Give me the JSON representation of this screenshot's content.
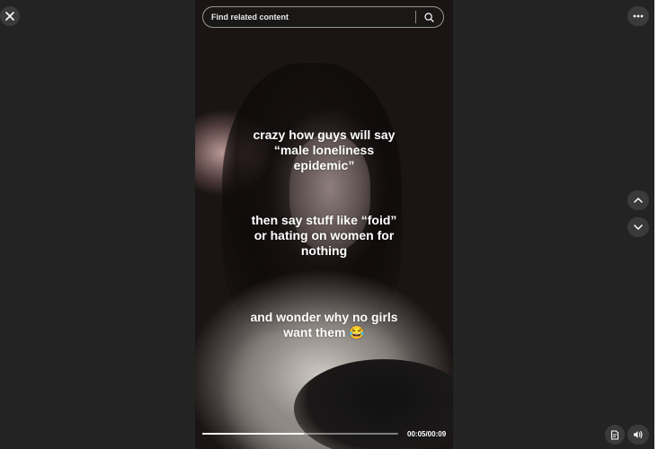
{
  "search": {
    "placeholder": "Find related content"
  },
  "captions": {
    "line1": "crazy how guys will say “male loneliness epidemic”",
    "line2": "then say stuff like “foid” or hating on women for nothing",
    "line3": "and wonder why no girls want them 😂"
  },
  "player": {
    "time": "00:05/00:09",
    "progress_fraction": 0.52
  },
  "icons": {
    "close": "close-icon",
    "more": "more-horizontal-icon",
    "search": "search-icon",
    "up": "chevron-up-icon",
    "down": "chevron-down-icon",
    "captions": "captions-icon",
    "volume": "volume-icon"
  },
  "colors": {
    "background": "#232323",
    "button": "#3b3b3b",
    "text": "#ffffff"
  }
}
